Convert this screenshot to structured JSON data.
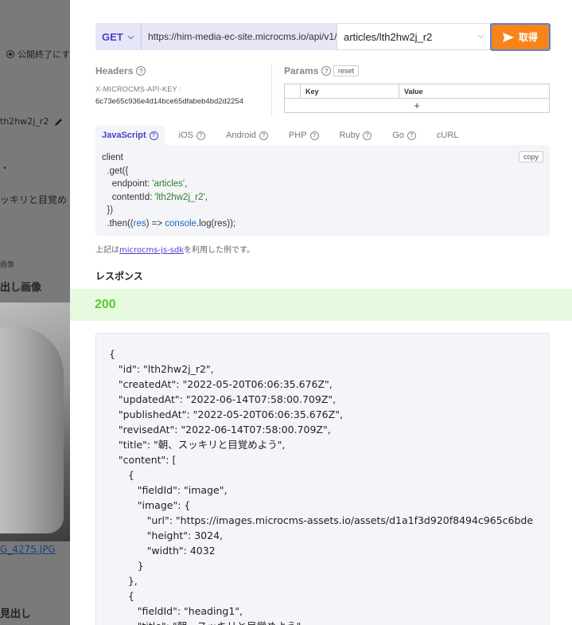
{
  "background": {
    "unpublish_label": "公開終了にす",
    "id_fragment": "th2hw2j_r2",
    "title_fragment": "ッキリと目覚め",
    "small_label": "画像",
    "image_heading": "出し画像",
    "file_link": "G_4275.JPG",
    "bottom_heading": "見出し",
    "colon_mark": "・"
  },
  "request": {
    "method": "GET",
    "base_url": "https://him-media-ec-site.microcms.io/api/v1/",
    "endpoint": "articles/lth2hw2j_r2",
    "fetch_label": "取得"
  },
  "headers": {
    "label": "Headers",
    "key": "X-MICROCMS-API-KEY :",
    "value": "6c73e65c936e4d14bce65dfabeb4bd2d2254"
  },
  "params": {
    "label": "Params",
    "reset_label": "reset",
    "columns": [
      "Key",
      "Value"
    ],
    "add_label": "+"
  },
  "tabs": [
    {
      "label": "JavaScript",
      "active": true
    },
    {
      "label": "iOS",
      "active": false
    },
    {
      "label": "Android",
      "active": false
    },
    {
      "label": "PHP",
      "active": false
    },
    {
      "label": "Ruby",
      "active": false
    },
    {
      "label": "Go",
      "active": false
    },
    {
      "label": "cURL",
      "active": false
    }
  ],
  "code": {
    "copy_label": "copy",
    "l1": "client",
    "l2": "  .get({",
    "l3a": "    endpoint: ",
    "l3b": "'articles'",
    "l3c": ",",
    "l4a": "    contentId: ",
    "l4b": "'lth2hw2j_r2'",
    "l4c": ",",
    "l5": "  })",
    "l6a": "  .then((",
    "l6b": "res",
    "l6c": ") => ",
    "l6d": "console",
    "l6e": ".log(res));"
  },
  "sdk_note": {
    "prefix": "上記は",
    "link": "microcms-js-sdk",
    "suffix": "を利用した例です。"
  },
  "response": {
    "title": "レスポンス",
    "status": "200",
    "lines": [
      "{",
      "   \"id\": \"lth2hw2j_r2\",",
      "   \"createdAt\": \"2022-05-20T06:06:35.676Z\",",
      "   \"updatedAt\": \"2022-06-14T07:58:00.709Z\",",
      "   \"publishedAt\": \"2022-05-20T06:06:35.676Z\",",
      "   \"revisedAt\": \"2022-06-14T07:58:00.709Z\",",
      "   \"title\": \"朝、スッキリと目覚めよう\",",
      "   \"content\": [",
      "      {",
      "         \"fieldId\": \"image\",",
      "         \"image\": {",
      "            \"url\": \"https://images.microcms-assets.io/assets/d1a1f3d920f8494c965c6bde",
      "            \"height\": 3024,",
      "            \"width\": 4032",
      "         }",
      "      },",
      "      {",
      "         \"fieldId\": \"heading1\",",
      "         \"title\": \"朝、スッキリと目覚めよう\","
    ]
  }
}
